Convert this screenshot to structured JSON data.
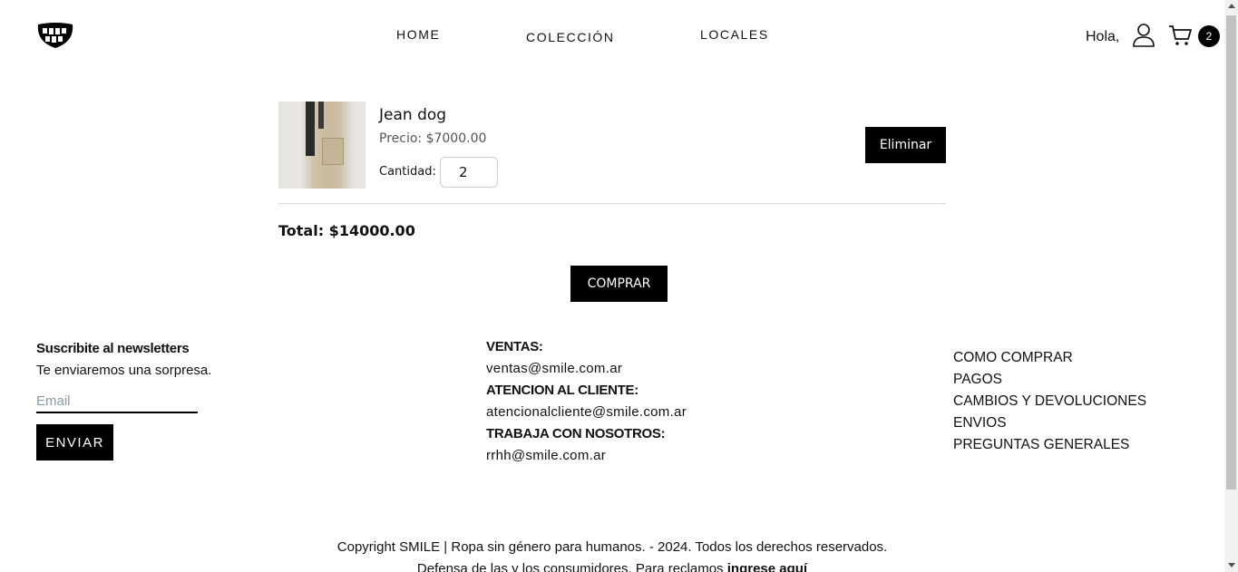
{
  "header": {
    "logo_icon": "smile-teeth-logo-icon",
    "nav": [
      "HOME",
      "COLECCIÓN",
      "LOCALES"
    ],
    "greeting": "Hola,",
    "user_icon": "user-icon",
    "cart_icon": "cart-icon",
    "cart_count": "2"
  },
  "cart": {
    "item": {
      "name": "Jean dog",
      "price": "Precio: $7000.00",
      "quantity_label": "Cantidad:",
      "quantity": "2",
      "remove_label": "Eliminar"
    },
    "total": "Total: $14000.00",
    "buy_label": "COMPRAR"
  },
  "footer": {
    "newsletter": {
      "title": "Suscribite al newsletters",
      "subtitle": "Te enviaremos una sorpresa.",
      "email_placeholder": "Email",
      "button": "ENVIAR"
    },
    "contact": [
      {
        "heading": "VENTAS:",
        "value": "ventas@smile.com.ar"
      },
      {
        "heading": "ATENCION AL CLIENTE:",
        "value": "atencionalcliente@smile.com.ar"
      },
      {
        "heading": "TRABAJA CON NOSOTROS:",
        "value": "rrhh@smile.com.ar"
      }
    ],
    "links": [
      "COMO COMPRAR",
      "PAGOS",
      "CAMBIOS Y DEVOLUCIONES",
      "ENVIOS",
      "PREGUNTAS GENERALES"
    ],
    "copyright": "Copyright SMILE | Ropa sin género para humanos. - 2024. Todos los derechos reservados.",
    "consumer_text": "Defensa de las y los consumidores. Para reclamos",
    "consumer_link": "ingrese aquí"
  }
}
